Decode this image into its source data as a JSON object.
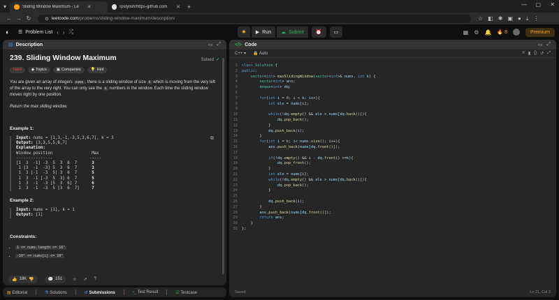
{
  "browser": {
    "tabs": [
      {
        "title": "Sliding Window Maximum - Le",
        "active": true,
        "favicon_color": "#ffa116"
      },
      {
        "title": "rpstylish/https-github.com-rp",
        "active": false,
        "favicon_color": "#e0e0e0"
      }
    ],
    "url_host": "leetcode.com",
    "url_path": "/problems/sliding-window-maximum/description/"
  },
  "nav": {
    "problem_list": "Problem List",
    "run": "Run",
    "submit": "Submit",
    "streak": "8",
    "premium": "Premium"
  },
  "description": {
    "header": "Description",
    "title": "239. Sliding Window Maximum",
    "solved": "Solved",
    "chips": [
      "Hard",
      "Topics",
      "Companies",
      "Hint"
    ],
    "p1_a": "You are given an array of integers ",
    "p1_code1": "nums",
    "p1_b": ", there is a sliding window of size ",
    "p1_code2": "k",
    "p1_c": " which is moving from the very left of the array to the very right. You can only see the ",
    "p1_code3": "k",
    "p1_d": " numbers in the window. Each time the sliding window moves right by one position.",
    "p2": "Return the max sliding window.",
    "ex1_title": "Example 1:",
    "ex1_input_label": "Input:",
    "ex1_input": " nums = [1,3,-1,-3,5,3,6,7], k = 3",
    "ex1_output_label": "Output:",
    "ex1_output": " [3,3,5,5,6,7]",
    "ex1_expl_label": "Explanation:",
    "ex1_table_header": "Window position                Max",
    "ex1_table_rule": "---------------               -----",
    "ex1_rows": [
      {
        "w": "[1  3  -1] -3  5  3  6  7",
        "m": "3"
      },
      {
        "w": " 1 [3  -1  -3] 5  3  6  7",
        "m": "3"
      },
      {
        "w": " 1  3 [-1  -3  5] 3  6  7",
        "m": "5"
      },
      {
        "w": " 1  3  -1 [-3  5  3] 6  7",
        "m": "5"
      },
      {
        "w": " 1  3  -1  -3 [5  3  6] 7",
        "m": "6"
      },
      {
        "w": " 1  3  -1  -3  5 [3  6  7]",
        "m": "7"
      }
    ],
    "ex2_title": "Example 2:",
    "ex2_input_label": "Input:",
    "ex2_input": " nums = [1], k = 1",
    "ex2_output_label": "Output:",
    "ex2_output": " [1]",
    "constraints_title": "Constraints:",
    "c1": "1 <= nums.length <= 10⁵",
    "c2": "-10⁴ <= nums[i] <= 10⁴",
    "likes": "18K",
    "comments": "151"
  },
  "code": {
    "header": "Code",
    "lang": "C++",
    "auto": "Auto",
    "status": "Saved",
    "position": "Ln 21, Col 3"
  },
  "bottom_tabs": [
    "Editorial",
    "Solutions",
    "Submissions",
    "Test Result",
    "Testcase"
  ]
}
